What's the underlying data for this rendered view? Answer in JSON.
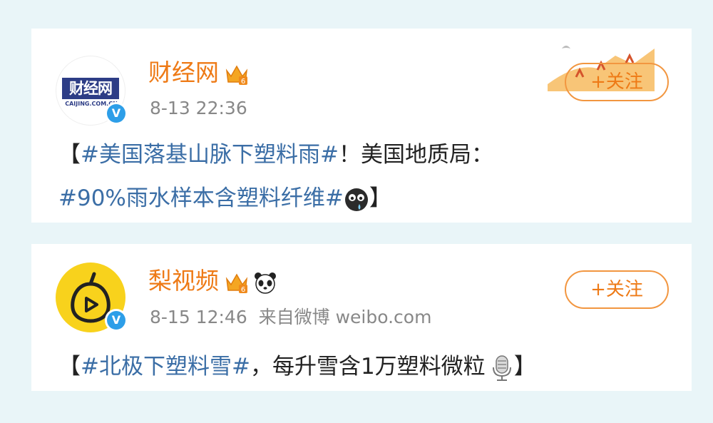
{
  "posts": [
    {
      "avatar_text": "财经网",
      "avatar_subtext": "CAIJING.COM.CN",
      "username": "财经网",
      "crown_level": "6",
      "time": "8-13 22:36",
      "source": "",
      "follow_label": "+关注",
      "verified_mark": "V",
      "lines": [
        {
          "open": "【",
          "tag": "#美国落基山脉下塑料雨#",
          "text": "！美国地质局：",
          "close": ""
        },
        {
          "open": "",
          "tag": "#90%雨水样本含塑料纤维#",
          "text": "",
          "close": "】"
        }
      ],
      "emoji": "crying-face-icon"
    },
    {
      "username": "梨视频",
      "crown_level": "6",
      "time": "8-15 12:46",
      "source": "来自微博 weibo.com",
      "follow_label": "+关注",
      "verified_mark": "V",
      "lines": [
        {
          "open": "【",
          "tag": "#北极下塑料雪#",
          "text": "，每升雪含1万塑料微粒",
          "close": "】"
        }
      ],
      "emoji": "microphone-icon"
    }
  ],
  "colors": {
    "accent": "#ee7a16",
    "tag": "#3b6ea6",
    "verified": "#2d9ee8",
    "background": "#e9f5f8"
  }
}
